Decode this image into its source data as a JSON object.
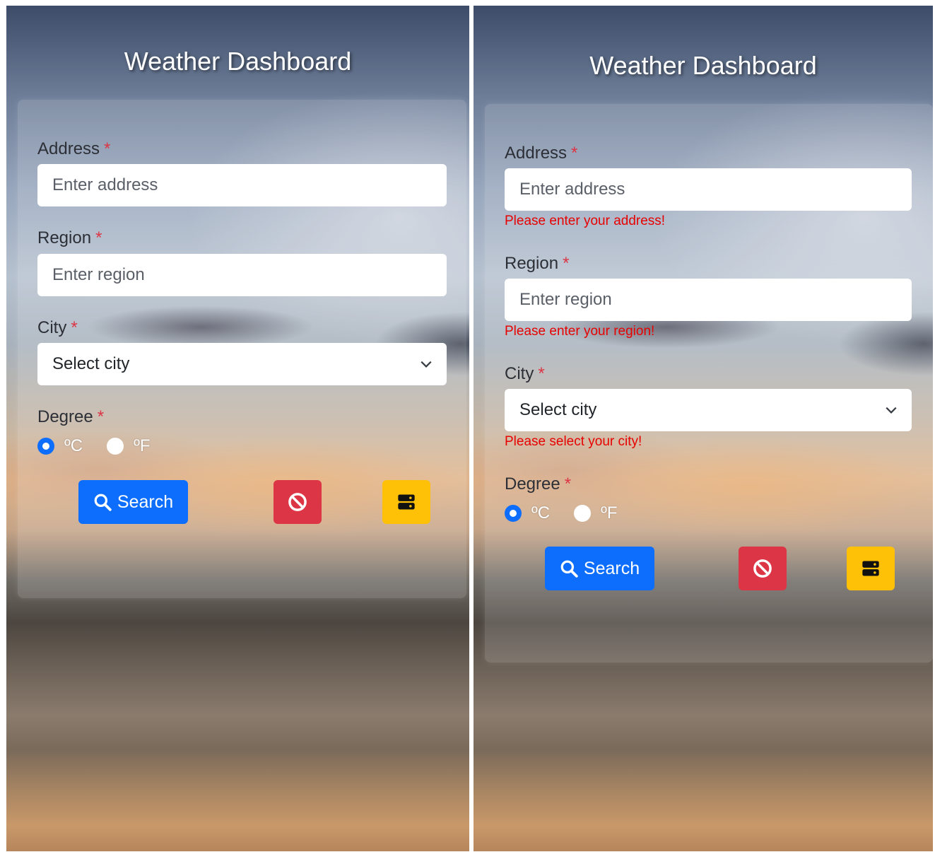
{
  "app_title": "Weather Dashboard",
  "form": {
    "address": {
      "label": "Address",
      "required_mark": "*",
      "placeholder": "Enter address",
      "error": "Please enter your address!"
    },
    "region": {
      "label": "Region",
      "required_mark": "*",
      "placeholder": "Enter region",
      "error": "Please enter your region!"
    },
    "city": {
      "label": "City",
      "required_mark": "*",
      "selected": "Select city",
      "error": "Please select your city!"
    },
    "degree": {
      "label": "Degree",
      "required_mark": "*",
      "options": [
        {
          "label": "ºC",
          "checked": true
        },
        {
          "label": "ºF",
          "checked": false
        }
      ]
    }
  },
  "buttons": {
    "search_label": "Search",
    "search_icon": "search-icon",
    "clear_icon": "ban-icon",
    "history_icon": "storage-icon"
  },
  "colors": {
    "primary": "#0d6efd",
    "danger": "#dc3545",
    "warning": "#ffc107",
    "error_text": "#e60000"
  }
}
